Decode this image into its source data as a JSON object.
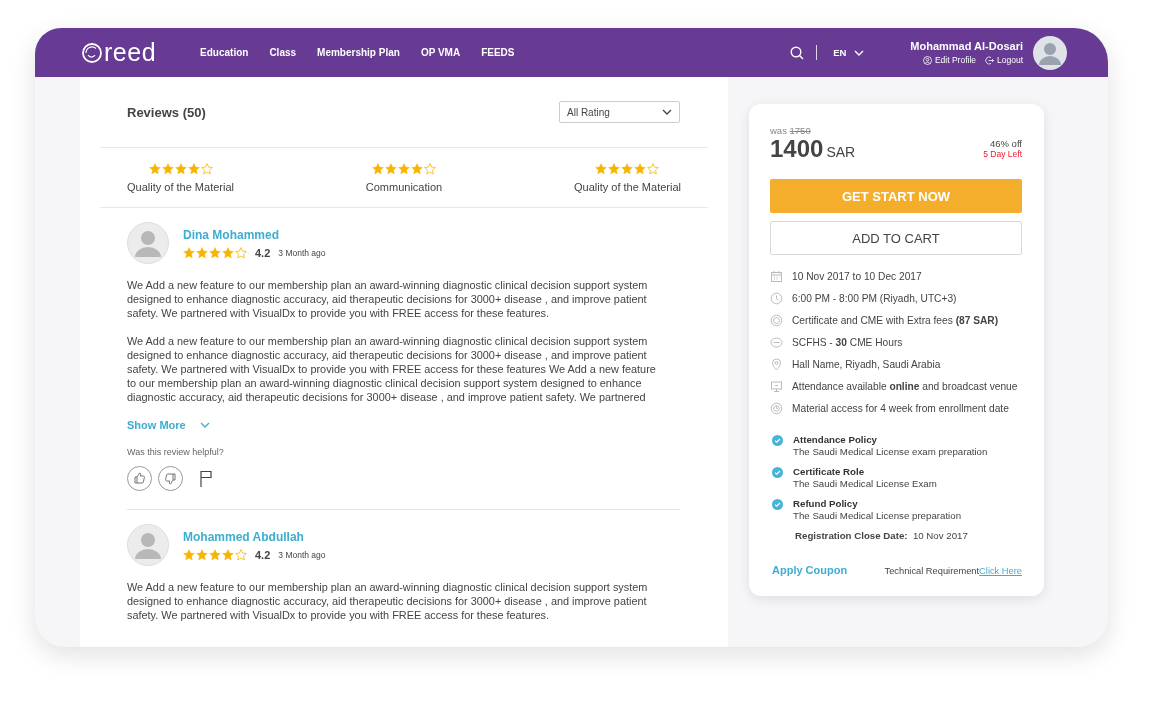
{
  "header": {
    "logo": "reed",
    "nav": [
      "Education",
      "Class",
      "Membership Plan",
      "OP VMA",
      "FEEDS"
    ],
    "language": "EN",
    "user": {
      "name": "Mohammad Al-Dosari",
      "edit_profile": "Edit Profile",
      "logout": "Logout"
    }
  },
  "reviews": {
    "title": "Reviews (50)",
    "filter": "All Rating",
    "ratings": [
      {
        "stars": 4,
        "label": "Quality of the Material"
      },
      {
        "stars": 4,
        "label": "Communication"
      },
      {
        "stars": 4,
        "label": "Quality of the Material"
      }
    ],
    "items": [
      {
        "name": "Dina Mohammed",
        "stars": 4,
        "score": "4.2",
        "time": "3 Month ago",
        "paragraphs": [
          "We Add a new feature to our membership plan an award-winning diagnostic clinical decision support system designed to enhance diagnostic accuracy, aid therapeutic decisions for 3000+ disease , and improve patient safety. We partnered with VisualDx to provide you with FREE access for these features.",
          "We Add a new feature to our membership plan an award-winning diagnostic clinical decision support system designed to enhance diagnostic accuracy, aid therapeutic decisions for 3000+ disease , and improve patient safety. We partnered with VisualDx to provide you with FREE access for these features We Add a new feature to our membership plan an award-winning diagnostic clinical decision support system designed to enhance diagnostic accuracy, aid therapeutic decisions for 3000+ disease , and improve patient safety. We partnered"
        ],
        "show_more": "Show More",
        "helpful_prompt": "Was this review helpful?"
      },
      {
        "name": "Mohammed Abdullah",
        "stars": 4,
        "score": "4.2",
        "time": "3 Month ago",
        "paragraphs": [
          "We Add a new feature to our membership plan an award-winning diagnostic clinical decision support system designed to enhance diagnostic accuracy, aid therapeutic decisions for 3000+ disease , and improve patient safety. We partnered with VisualDx to provide you with FREE access for these features."
        ]
      }
    ]
  },
  "offer": {
    "was_label": "was",
    "old_price": "1750",
    "price": "1400",
    "currency": "SAR",
    "discount": "46% off",
    "days_left": "5 Day Left",
    "primary_button": "GET START NOW",
    "secondary_button": "ADD TO CART",
    "details": [
      {
        "kind": "date",
        "text": "10 Nov 2017 to 10 Dec 2017"
      },
      {
        "kind": "time",
        "text": "6:00 PM - 8:00 PM (Riyadh, UTC+3)"
      },
      {
        "kind": "certificate",
        "text": "Certificate and CME with Extra fees **(87 SAR)**"
      },
      {
        "kind": "hours",
        "text": "SCFHS - **30** CME Hours"
      },
      {
        "kind": "location",
        "text": "Hall Name, Riyadh, Saudi Arabia"
      },
      {
        "kind": "attendance",
        "text": "Attendance available **online** and broadcast venue"
      },
      {
        "kind": "access",
        "text": "Material access for 4 week from enrollment date"
      }
    ],
    "policies": [
      {
        "checked": true,
        "title": "Attendance Policy",
        "text": "The Saudi Medical License exam preparation"
      },
      {
        "checked": true,
        "title": "Certificate Role",
        "text": "The Saudi Medical License Exam"
      },
      {
        "checked": true,
        "title": "Refund Policy",
        "text": "The Saudi Medical License preparation"
      }
    ],
    "registration": {
      "label": "Registration Close Date:",
      "value": "10 Nov 2017"
    },
    "coupon": "Apply Coupon",
    "requirement": "Technical Requirement",
    "requirement_link": "Click Here"
  }
}
